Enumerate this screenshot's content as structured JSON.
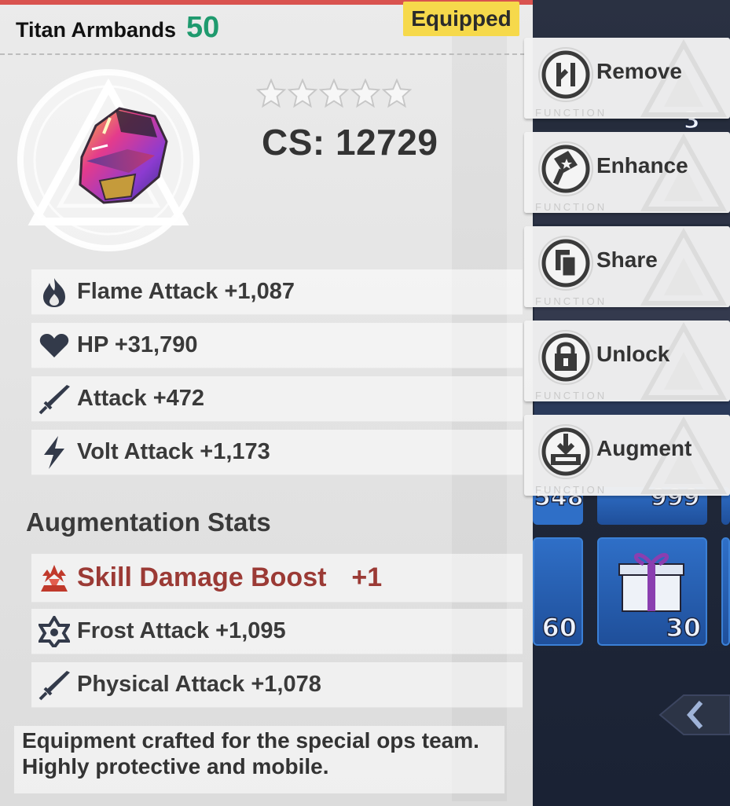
{
  "item": {
    "name": "Titan Armbands",
    "level": "50",
    "badge": "Equipped",
    "stars_filled": 0,
    "stars_total": 5,
    "cs": "CS: 12729"
  },
  "stats": [
    {
      "icon": "flame-icon",
      "text": "Flame Attack +1,087"
    },
    {
      "icon": "heart-icon",
      "text": "HP +31,790"
    },
    {
      "icon": "sword-icon",
      "text": "Attack +472"
    },
    {
      "icon": "lightning-icon",
      "text": "Volt Attack +1,173"
    }
  ],
  "augmentation": {
    "header": "Augmentation Stats",
    "special": {
      "icon": "skill-damage-icon",
      "label": "Skill Damage Boost",
      "value": "+1"
    },
    "stats": [
      {
        "icon": "frost-icon",
        "text": "Frost Attack +1,095"
      },
      {
        "icon": "sword-icon",
        "text": "Physical Attack +1,078"
      }
    ]
  },
  "description": "Equipment crafted for the special ops team. Highly protective and mobile.",
  "actions": [
    {
      "label": "Remove",
      "icon": "remove-icon",
      "func": "FUNCTION"
    },
    {
      "label": "Enhance",
      "icon": "hammer-icon",
      "func": "FUNCTION"
    },
    {
      "label": "Share",
      "icon": "share-icon",
      "func": "FUNCTION"
    },
    {
      "label": "Unlock",
      "icon": "lock-icon",
      "func": "FUNCTION"
    },
    {
      "label": "Augment",
      "icon": "augment-icon",
      "func": "FUNCTION"
    }
  ],
  "inventory": {
    "counts": [
      "3",
      "548",
      "999",
      "60",
      "30"
    ]
  },
  "colors": {
    "level": "#1f9a6e",
    "badge": "#f6d94b",
    "augment_special": "#9b3a35",
    "top_bar": "#d9534f"
  }
}
